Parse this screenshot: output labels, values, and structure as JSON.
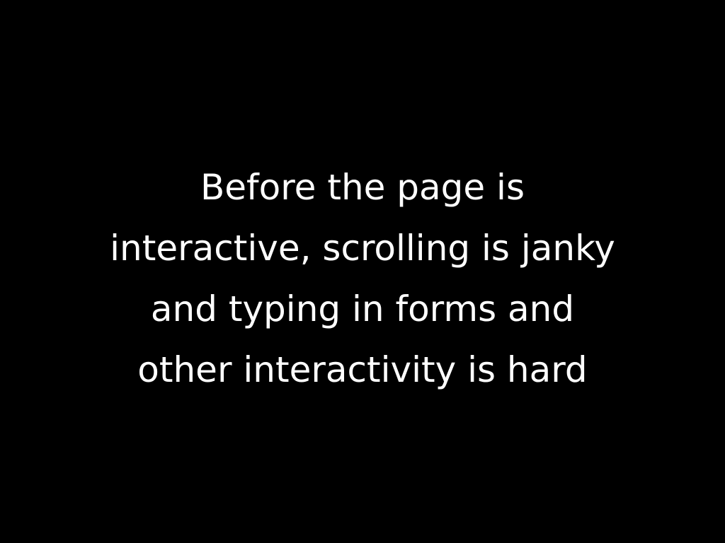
{
  "slide": {
    "background_color": "#000000",
    "text_color": "#ffffff",
    "lines": [
      "Before the page is",
      "interactive, scrolling is janky",
      "and typing in forms and",
      "other interactivity is hard"
    ]
  }
}
